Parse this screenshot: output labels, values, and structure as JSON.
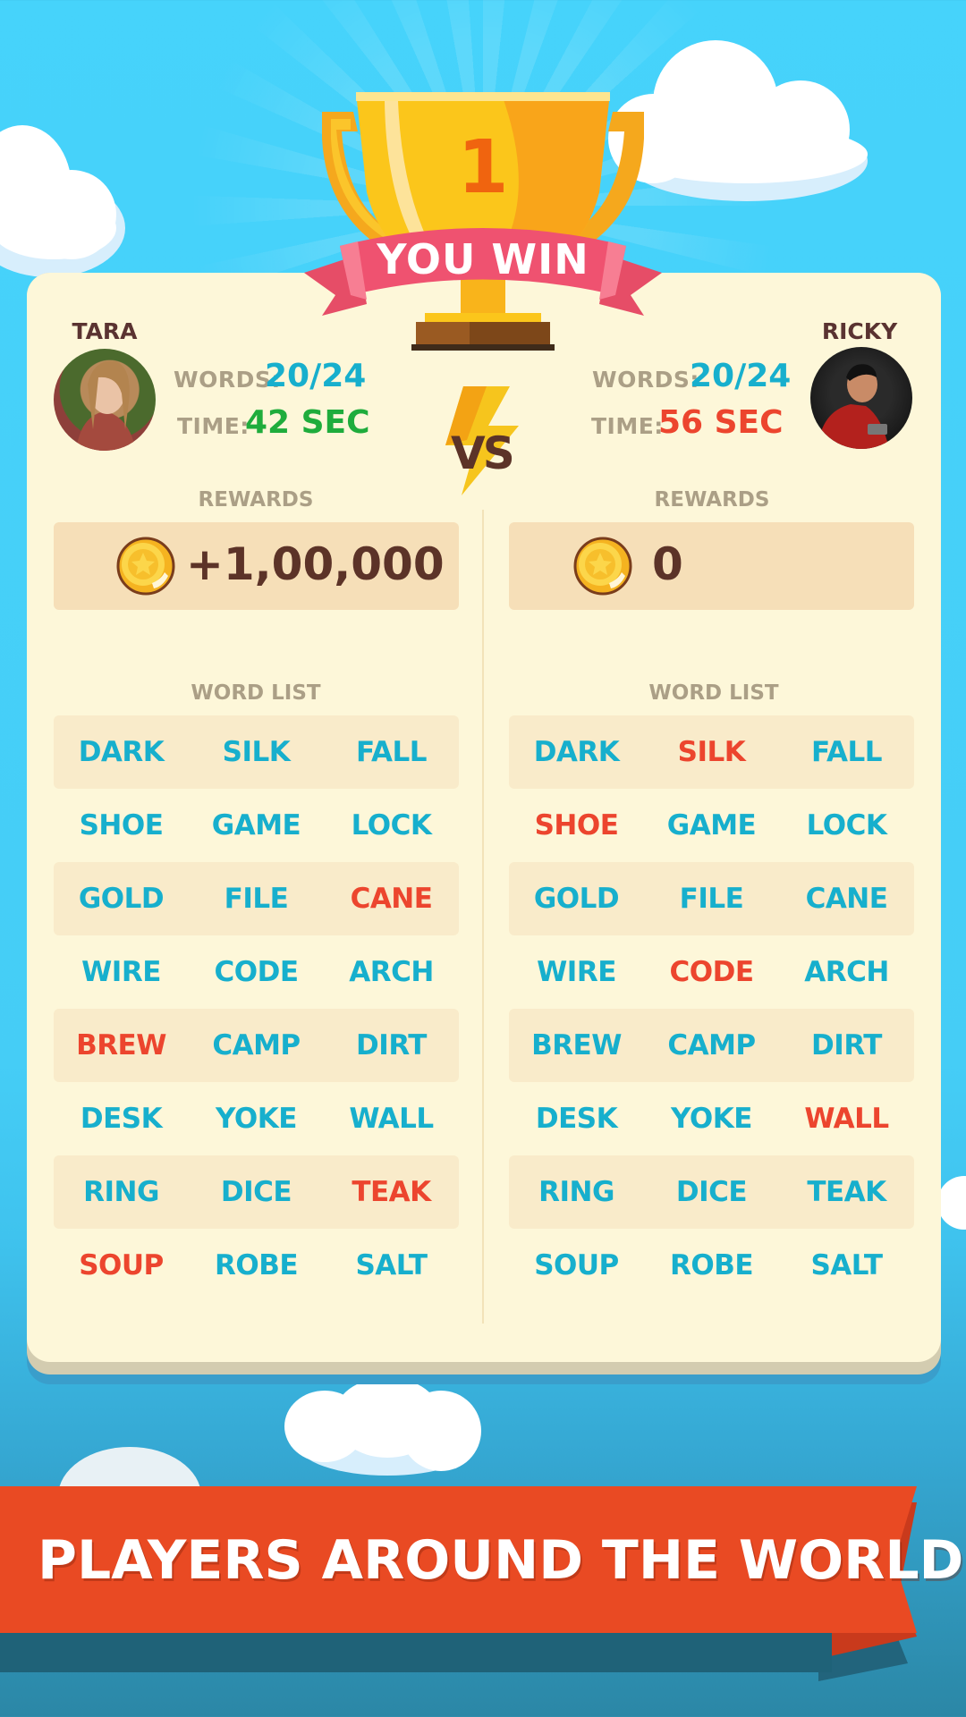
{
  "header": {
    "trophy_rank": "1",
    "result_banner": "YOU WIN"
  },
  "colors": {
    "found_word": "#17afcd",
    "missed_word": "#ec452e",
    "fast_time": "#1fac3c",
    "slow_time": "#ec452e",
    "label": "#ab9f86",
    "name": "#5a3331",
    "promo_banner": "#e94a23"
  },
  "versus_label": "VS",
  "players": [
    {
      "name": "TARA",
      "avatar_icon": "player-photo-tara",
      "words_label": "WORDS:",
      "words_value": "20/24",
      "time_label": "TIME:",
      "time_value": "42 SEC",
      "time_status": "fast",
      "rewards_label": "REWARDS",
      "reward_icon": "gold-coin-icon",
      "reward_value": "+1,00,000",
      "word_list_label": "WORD LIST",
      "words": [
        [
          {
            "text": "DARK",
            "found": true
          },
          {
            "text": "SILK",
            "found": true
          },
          {
            "text": "FALL",
            "found": true
          }
        ],
        [
          {
            "text": "SHOE",
            "found": true
          },
          {
            "text": "GAME",
            "found": true
          },
          {
            "text": "LOCK",
            "found": true
          }
        ],
        [
          {
            "text": "GOLD",
            "found": true
          },
          {
            "text": "FILE",
            "found": true
          },
          {
            "text": "CANE",
            "found": false
          }
        ],
        [
          {
            "text": "WIRE",
            "found": true
          },
          {
            "text": "CODE",
            "found": true
          },
          {
            "text": "ARCH",
            "found": true
          }
        ],
        [
          {
            "text": "BREW",
            "found": false
          },
          {
            "text": "CAMP",
            "found": true
          },
          {
            "text": "DIRT",
            "found": true
          }
        ],
        [
          {
            "text": "DESK",
            "found": true
          },
          {
            "text": "YOKE",
            "found": true
          },
          {
            "text": "WALL",
            "found": true
          }
        ],
        [
          {
            "text": "RING",
            "found": true
          },
          {
            "text": "DICE",
            "found": true
          },
          {
            "text": "TEAK",
            "found": false
          }
        ],
        [
          {
            "text": "SOUP",
            "found": false
          },
          {
            "text": "ROBE",
            "found": true
          },
          {
            "text": "SALT",
            "found": true
          }
        ]
      ]
    },
    {
      "name": "RICKY",
      "avatar_icon": "player-photo-ricky",
      "words_label": "WORDS:",
      "words_value": "20/24",
      "time_label": "TIME:",
      "time_value": "56 SEC",
      "time_status": "slow",
      "rewards_label": "REWARDS",
      "reward_icon": "gold-coin-icon",
      "reward_value": "0",
      "word_list_label": "WORD LIST",
      "words": [
        [
          {
            "text": "DARK",
            "found": true
          },
          {
            "text": "SILK",
            "found": false
          },
          {
            "text": "FALL",
            "found": true
          }
        ],
        [
          {
            "text": "SHOE",
            "found": false
          },
          {
            "text": "GAME",
            "found": true
          },
          {
            "text": "LOCK",
            "found": true
          }
        ],
        [
          {
            "text": "GOLD",
            "found": true
          },
          {
            "text": "FILE",
            "found": true
          },
          {
            "text": "CANE",
            "found": true
          }
        ],
        [
          {
            "text": "WIRE",
            "found": true
          },
          {
            "text": "CODE",
            "found": false
          },
          {
            "text": "ARCH",
            "found": true
          }
        ],
        [
          {
            "text": "BREW",
            "found": true
          },
          {
            "text": "CAMP",
            "found": true
          },
          {
            "text": "DIRT",
            "found": true
          }
        ],
        [
          {
            "text": "DESK",
            "found": true
          },
          {
            "text": "YOKE",
            "found": true
          },
          {
            "text": "WALL",
            "found": false
          }
        ],
        [
          {
            "text": "RING",
            "found": true
          },
          {
            "text": "DICE",
            "found": true
          },
          {
            "text": "TEAK",
            "found": true
          }
        ],
        [
          {
            "text": "SOUP",
            "found": true
          },
          {
            "text": "ROBE",
            "found": true
          },
          {
            "text": "SALT",
            "found": true
          }
        ]
      ]
    }
  ],
  "promo": {
    "banner_text": "PLAYERS AROUND THE WORLD"
  }
}
